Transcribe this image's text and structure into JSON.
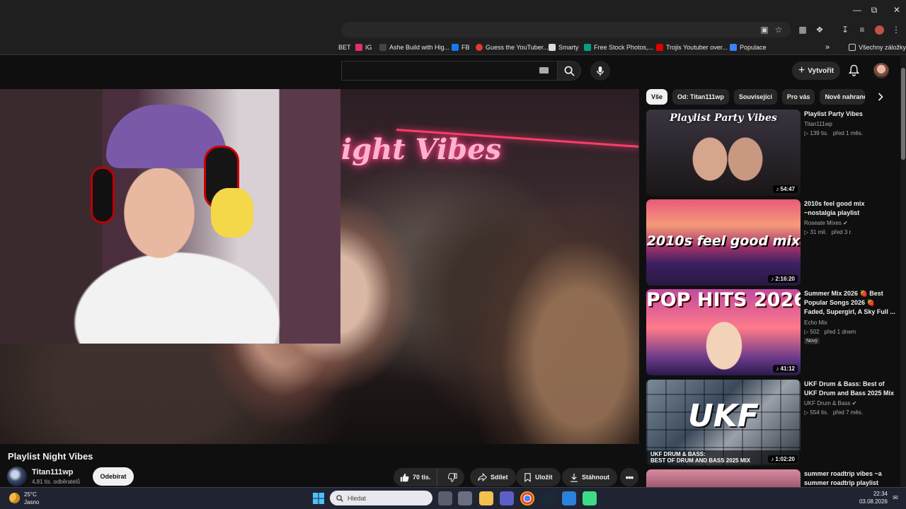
{
  "browser": {
    "bookmarks": [
      {
        "label": "BET",
        "icon": "bookmark-icon",
        "color": "#999999"
      },
      {
        "label": "IG",
        "icon": "instagram-icon",
        "color": "#e1306c"
      },
      {
        "label": "Ashe Build with Hig...",
        "icon": "bookmark-icon",
        "color": "#444444"
      },
      {
        "label": "FB",
        "icon": "facebook-icon",
        "color": "#1877f2"
      },
      {
        "label": "Guess the YouTuber...",
        "icon": "quiz-icon",
        "color": "#e53935"
      },
      {
        "label": "Smarty",
        "icon": "smarty-icon",
        "color": "#dddddd"
      },
      {
        "label": "Free Stock Photos,...",
        "icon": "pexels-icon",
        "color": "#05a081"
      },
      {
        "label": "Trojis Youtuber over...",
        "icon": "youtube-icon",
        "color": "#e00000"
      },
      {
        "label": "Populace",
        "icon": "chart-icon",
        "color": "#3b82f6"
      }
    ],
    "all_bookmarks_label": "Všechny záložky"
  },
  "youtube": {
    "create_label": "Vytvořit",
    "video": {
      "overlay_text": "ight Vibes",
      "title": "Playlist Night Vibes",
      "channel": "Titan111wp",
      "subscribers": "4,81 tis. odběratelů",
      "unsubscribe_label": "Odebírat",
      "likes": "70 tis.",
      "share_label": "Sdílet",
      "save_label": "Uložit",
      "download_label": "Stáhnout"
    },
    "chips": [
      "Vše",
      "Od: Titan111wp",
      "Související",
      "Pro vás",
      "Nově nahrané"
    ],
    "recommendations": [
      {
        "title": "Playlist Party Vibes",
        "channel": "Titan111wp",
        "verified": false,
        "views": "139 tis.",
        "age": "před 1 měs.",
        "duration": "54:47",
        "thumb_text": "Playlist Party Vibes",
        "badge": ""
      },
      {
        "title": "2010s feel good mix ~nostalgia playlist",
        "channel": "Roseate Mixes",
        "verified": true,
        "views": "31 mil.",
        "age": "před 3 r.",
        "duration": "2:16:20",
        "thumb_text": "2010s feel good mix",
        "badge": ""
      },
      {
        "title": "Summer Mix 2026 🍓 Best Popular Songs 2026 🍓 Faded, Supergirl, A Sky Full ...",
        "channel": "Echo Mix",
        "verified": false,
        "views": "502",
        "age": "před 1 dnem",
        "duration": "41:12",
        "thumb_text": "POP HITS 2026",
        "badge": "Nový"
      },
      {
        "title": "UKF Drum & Bass: Best of UKF Drum and Bass 2025 Mix",
        "channel": "UKF Drum & Bass",
        "verified": true,
        "views": "554 tis.",
        "age": "před 7 měs.",
        "duration": "1:02:20",
        "thumb_text": "UKF",
        "thumb_caption_1": "UKF DRUM & BASS:",
        "thumb_caption_2": "BEST OF DRUM AND BASS 2025 MIX",
        "badge": ""
      },
      {
        "title": "summer roadtrip vibes ~a summer roadtrip playlist",
        "channel": "",
        "verified": false,
        "views": "",
        "age": "",
        "duration": "",
        "thumb_text": "",
        "badge": ""
      }
    ]
  },
  "taskbar": {
    "temperature": "25°C",
    "weather": "Jasno",
    "search_placeholder": "Hledat",
    "time": "22:34",
    "date": "03.08.2026"
  }
}
